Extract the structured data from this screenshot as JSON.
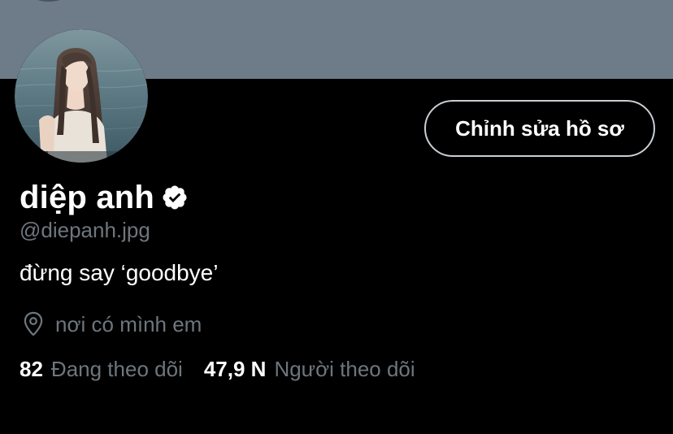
{
  "banner": {
    "color": "#6e7b88"
  },
  "profile": {
    "display_name": "diệp anh",
    "verified_icon": "verified-badge-icon",
    "handle": "@diepanh.jpg",
    "bio": "đừng say ‘goodbye’",
    "location": "nơi có mình em",
    "location_icon": "map-pin-icon",
    "avatar": "avatar"
  },
  "actions": {
    "edit_profile_label": "Chỉnh sửa hồ sơ"
  },
  "stats": {
    "following_count": "82",
    "following_label": "Đang theo dõi",
    "followers_count": "47,9 N",
    "followers_label": "Người theo dõi"
  },
  "colors": {
    "background": "#000000",
    "secondary_text": "#6e767d",
    "primary_text": "#ffffff",
    "button_border": "#c9cfd4"
  }
}
